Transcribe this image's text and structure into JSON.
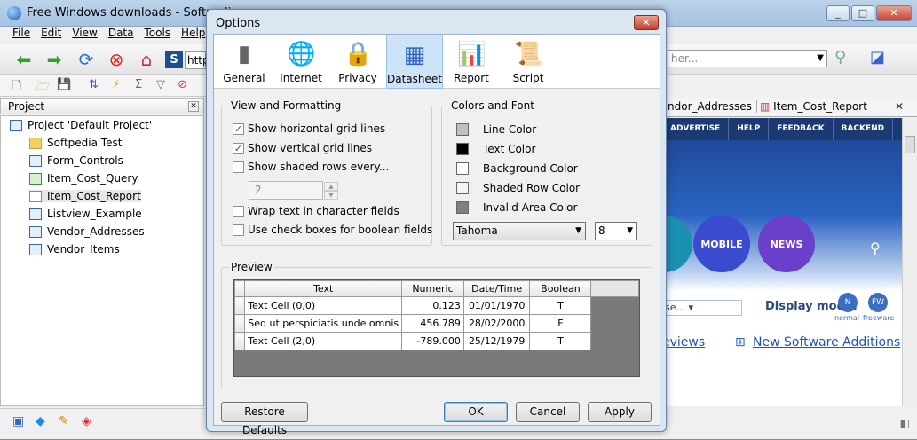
{
  "main_window": {
    "title": "Free Windows downloads - Softpedia",
    "controls": {
      "minimize": "_",
      "maximize": "□",
      "close": "✕"
    },
    "menu": [
      "File",
      "Edit",
      "View",
      "Data",
      "Tools",
      "Help"
    ],
    "address_partial": "http",
    "search_placeholder_partial": "her..."
  },
  "project_panel": {
    "title": "Project",
    "close": "✕",
    "root": "Project 'Default Project'",
    "items": [
      {
        "label": "Softpedia Test",
        "type": "folder"
      },
      {
        "label": "Form_Controls",
        "type": "form"
      },
      {
        "label": "Item_Cost_Query",
        "type": "query"
      },
      {
        "label": "Item_Cost_Report",
        "type": "report"
      },
      {
        "label": "Listview_Example",
        "type": "table"
      },
      {
        "label": "Vendor_Addresses",
        "type": "table"
      },
      {
        "label": "Vendor_Items",
        "type": "table"
      }
    ]
  },
  "browser": {
    "tabs": [
      "ndor_Addresses",
      "Item_Cost_Report"
    ],
    "nav": [
      "ADVERTISE",
      "HELP",
      "FEEDBACK",
      "BACKEND",
      "N"
    ],
    "bubbles": [
      {
        "label": "MOBILE",
        "color": "#3a4bd0"
      },
      {
        "label": "NEWS",
        "color": "#6a3fcc"
      }
    ],
    "select_partial": "se...",
    "display_mode_label": "Display mode:",
    "mode_normal": "normal",
    "mode_freeware": "freeware",
    "mode_n": "N",
    "mode_fw": "FW",
    "reviews_link": "eviews",
    "new_software_link": "New Software Additions"
  },
  "dialog": {
    "title": "Options",
    "close": "✕",
    "tabs": [
      {
        "label": "General",
        "icon": "switch-icon",
        "glyph": "▮"
      },
      {
        "label": "Internet",
        "icon": "globe-icon",
        "glyph": "🌐"
      },
      {
        "label": "Privacy",
        "icon": "lock-icon",
        "glyph": "🔒"
      },
      {
        "label": "Datasheet",
        "icon": "grid-icon",
        "glyph": "▦"
      },
      {
        "label": "Report",
        "icon": "report-icon",
        "glyph": "📊"
      },
      {
        "label": "Script",
        "icon": "script-icon",
        "glyph": "📜"
      }
    ],
    "view_group": {
      "title": "View and Formatting",
      "options": [
        {
          "label": "Show horizontal grid lines",
          "checked": true
        },
        {
          "label": "Show vertical grid lines",
          "checked": true
        },
        {
          "label": "Show shaded rows every...",
          "checked": false
        },
        {
          "label": "Wrap text in character fields",
          "checked": false
        },
        {
          "label": "Use check boxes for boolean fields",
          "checked": false
        }
      ],
      "shaded_every_value": "2"
    },
    "colors_group": {
      "title": "Colors and Font",
      "swatches": [
        {
          "label": "Line Color",
          "color": "#c0c0c0"
        },
        {
          "label": "Text Color",
          "color": "#000000"
        },
        {
          "label": "Background Color",
          "color": "#ffffff"
        },
        {
          "label": "Shaded Row Color",
          "color": "#f2f6fb"
        },
        {
          "label": "Invalid Area Color",
          "color": "#808080"
        }
      ],
      "font": "Tahoma",
      "font_size": "8"
    },
    "preview": {
      "title": "Preview",
      "columns": [
        "Text",
        "Numeric",
        "Date/Time",
        "Boolean"
      ],
      "rows": [
        [
          "Text Cell (0,0)",
          "0.123",
          "01/01/1970",
          "T"
        ],
        [
          "Sed ut perspiciatis unde omnis",
          "456.789",
          "28/02/2000",
          "F"
        ],
        [
          "Text Cell (2,0)",
          "-789.000",
          "25/12/1979",
          "T"
        ]
      ]
    },
    "buttons": {
      "restore": "Restore Defaults",
      "ok": "OK",
      "cancel": "Cancel",
      "apply": "Apply"
    }
  }
}
